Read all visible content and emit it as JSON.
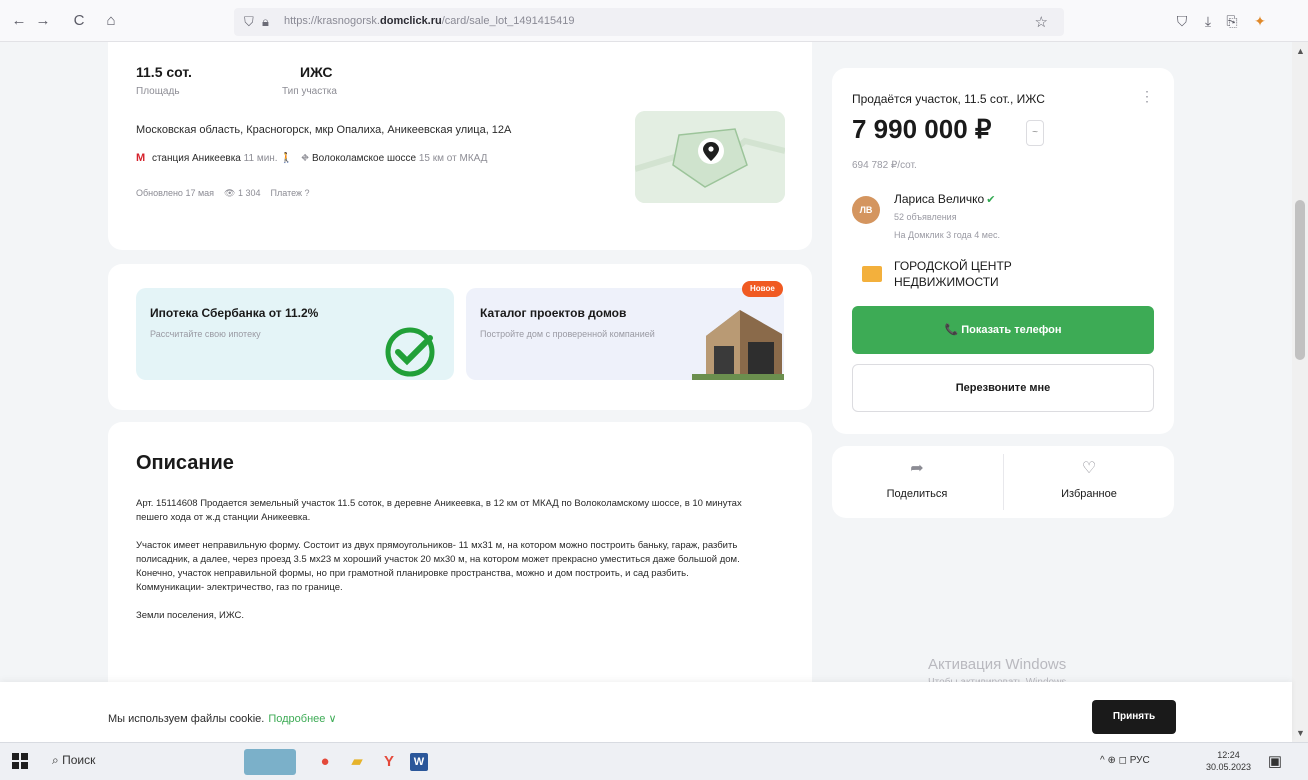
{
  "browser": {
    "back": "←",
    "forward": "→",
    "reload": "C",
    "home": "⌂",
    "url_prefix": "https://krasnogorsk.",
    "url_domain": "domclick.ru",
    "url_path": "/card/sale_lot_1491415419",
    "bookmark": "☆"
  },
  "listing": {
    "area_value": "11.5 сот.",
    "area_label": "Площадь",
    "type_value": "ИЖС",
    "type_label": "Тип участка",
    "address": "Московская область, Красногорск, мкр Опалиха, Аникеевская улица, 12А",
    "metro_icon": "М",
    "station": "станция Аникеевка",
    "station_time": "11 мин.",
    "walk_icon": "🚶",
    "highway_icon": "⛖",
    "highway": "Волоколамское шоссе",
    "highway_distance": "15 км от МКАД",
    "updated": "Обновлено 17 мая",
    "views_icon": "👁",
    "views": "1 304",
    "complaint": "Платеж",
    "complaint_icon": "?"
  },
  "promos": {
    "mortgage_title": "Ипотека Сбербанка от 11.2%",
    "mortgage_sub": "Рассчитайте свою ипотеку",
    "catalog_title": "Каталог проектов домов",
    "catalog_sub": "Постройте дом с проверенной компанией",
    "new_badge": "Новое"
  },
  "description": {
    "title": "Описание",
    "paragraphs": [
      "Арт. 15114608 Продается земельный участок 11.5 соток, в деревне Аникеевка, в 12 км от МКАД по Волоколамскому шоссе, в 10 минутах пешего хода от ж.д станции Аникеевка.",
      "Участок имеет неправильную форму. Состоит из двух прямоугольников- 11 мх31 м, на котором можно построить баньку, гараж, разбить полисадник, а далее, через проезд 3.5 мх23 м хороший участок 20 мх30 м, на котором может прекрасно уместиться даже большой дом. Конечно, участок неправильной формы, но при грамотной планировке пространства, можно и дом построить, и сад разбить. Коммуникации- электричество, газ по границе.",
      "Земли поселения, ИЖС."
    ]
  },
  "sidebar": {
    "title": "Продаётся участок, 11.5 сот., ИЖС",
    "menu": "⋮",
    "price": "7 990 000 ₽",
    "trend_icon": "~",
    "price_per_unit": "694 782 ₽/сот.",
    "avatar_initials": "ЛВ",
    "agent_name": "Лариса Величко",
    "verified_icon": "✔",
    "agent_listings": "52 объявления",
    "agent_since": "На Домклик 3 года 4 мес.",
    "agency": "ГОРОДСКОЙ ЦЕНТР НЕДВИЖИМОСТИ",
    "phone_button": "📞  Показать телефон",
    "callback_button": "Перезвоните мне",
    "share_icon": "➦",
    "share_label": "Поделиться",
    "favorite_icon": "♡",
    "favorite_label": "Избранное"
  },
  "watermark": {
    "title": "Активация Windows",
    "sub": "Чтобы активировать Windows, перейдите в раздел \"Параметры\"."
  },
  "cookie": {
    "text": "Мы используем файлы cookie.",
    "link": "Подробнее ∨",
    "accept": "Принять"
  },
  "taskbar": {
    "search_icon": "⌕",
    "search": "Поиск",
    "tray": "^ ⊕ ◻ РУС",
    "time": "12:24",
    "date": "30.05.2023"
  }
}
